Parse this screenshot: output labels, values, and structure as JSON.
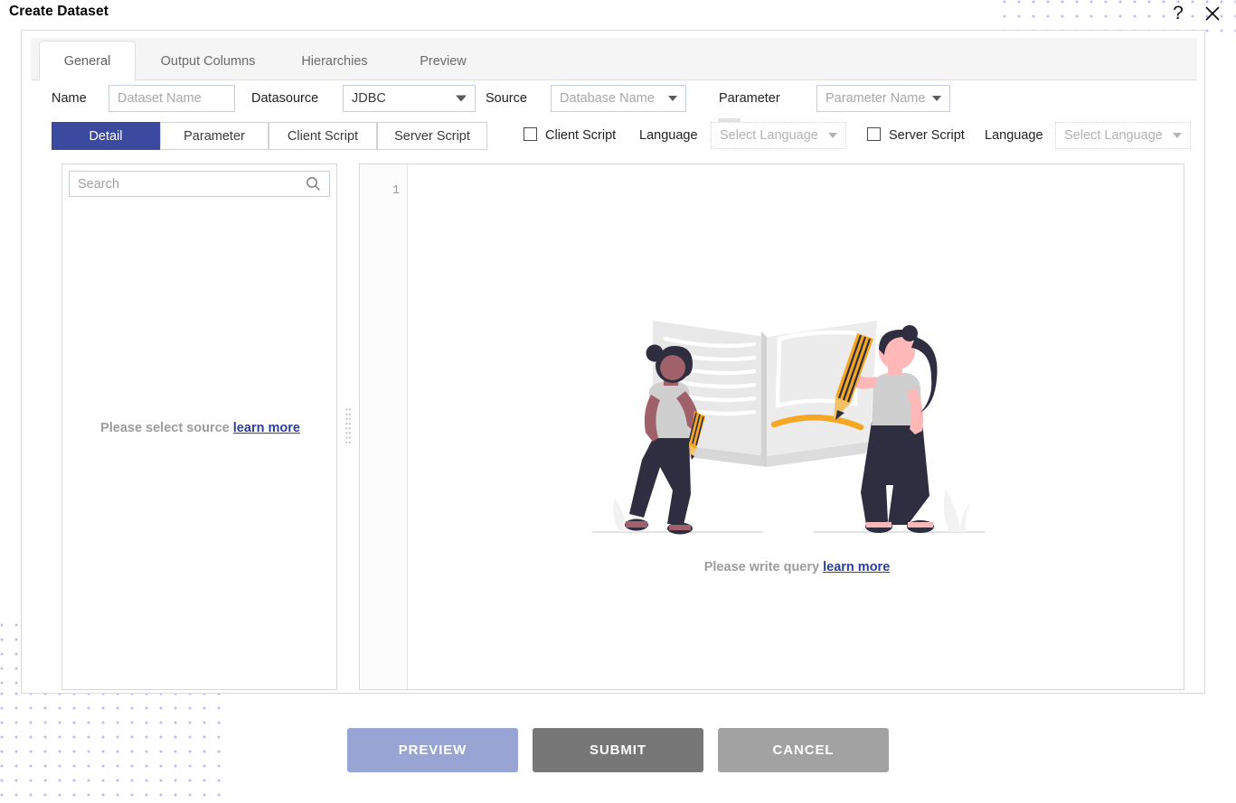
{
  "window": {
    "title": "Create Dataset",
    "help_icon": "question-mark-icon",
    "close_icon": "close-x-icon"
  },
  "tabs": [
    {
      "label": "General",
      "active": true
    },
    {
      "label": "Output Columns",
      "active": false
    },
    {
      "label": "Hierarchies",
      "active": false
    },
    {
      "label": "Preview",
      "active": false
    }
  ],
  "row1": {
    "name_label": "Name",
    "name_placeholder": "Dataset Name",
    "name_value": "",
    "datasource_label": "Datasource",
    "datasource_value": "JDBC",
    "source_label": "Source",
    "source_placeholder": "Database Name",
    "refresh_icon": "refresh-icon",
    "parameter_label": "Parameter",
    "parameter_placeholder": "Parameter Name"
  },
  "row2": {
    "segments": [
      {
        "label": "Detail",
        "selected": true
      },
      {
        "label": "Parameter",
        "selected": false
      },
      {
        "label": "Client Script",
        "selected": false
      },
      {
        "label": "Server Script",
        "selected": false
      }
    ],
    "client_script_checkbox_label": "Client Script",
    "client_script_language_label": "Language",
    "client_script_language_value": "Select Language",
    "client_script_checked": false,
    "server_script_checkbox_label": "Server Script",
    "server_script_language_label": "Language",
    "server_script_language_value": "Select Language",
    "server_script_checked": false
  },
  "left_panel": {
    "search_placeholder": "Search",
    "search_value": "",
    "search_icon": "search-icon",
    "empty_text": "Please select source",
    "empty_link": "learn more"
  },
  "editor": {
    "line_number": "1",
    "content": "",
    "empty_text": "Please write query",
    "empty_link": "learn more",
    "illustration": "two-people-writing-in-open-book-illustration"
  },
  "footer": {
    "preview_label": "PREVIEW",
    "submit_label": "SUBMIT",
    "cancel_label": "CANCEL"
  },
  "colors": {
    "accent_blue": "#3b4a9e",
    "link_blue": "#2b3f9e",
    "preview_button": "#98a4d3",
    "submit_button": "#777777",
    "cancel_button": "#a2a2a2",
    "dot_pattern": "#b9bfe6"
  }
}
